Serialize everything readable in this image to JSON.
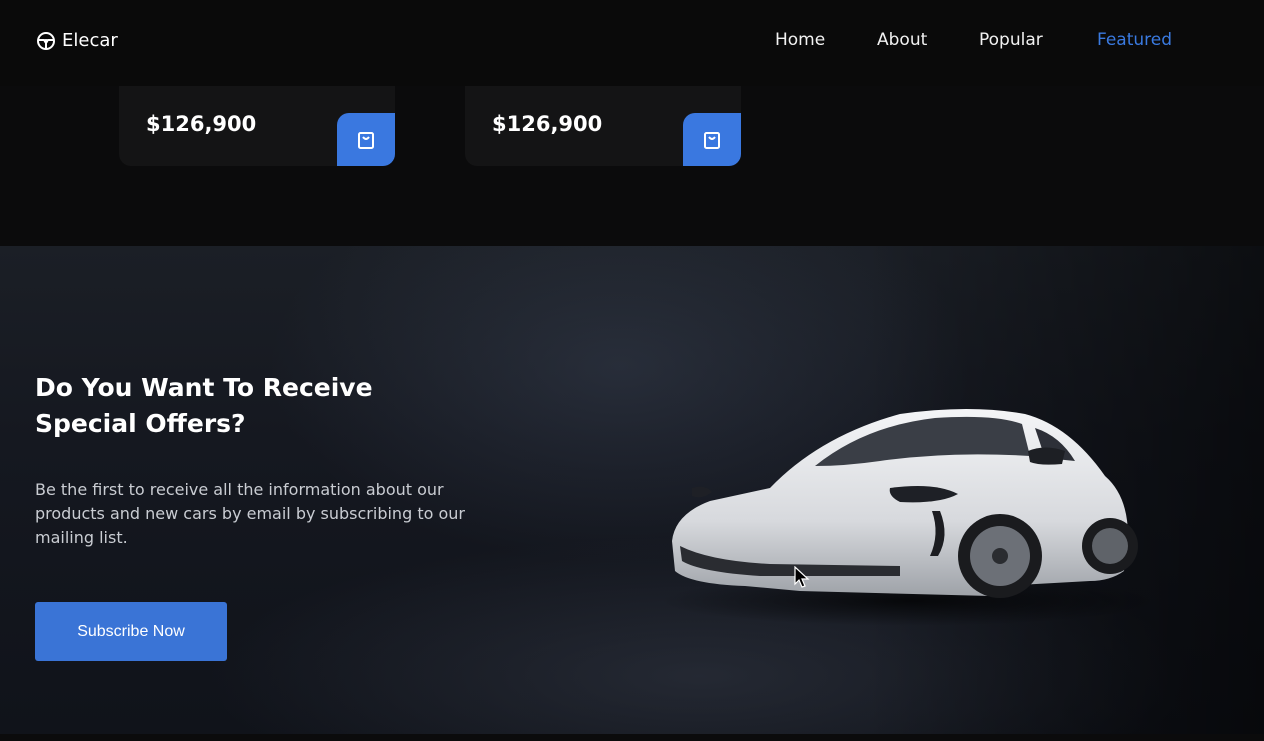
{
  "header": {
    "logo_text": "Elecar",
    "logo_icon": "steering-wheel-icon",
    "nav": [
      {
        "label": "Home",
        "active": false
      },
      {
        "label": "About",
        "active": false
      },
      {
        "label": "Popular",
        "active": false
      },
      {
        "label": "Featured",
        "active": true
      }
    ]
  },
  "featured": {
    "cards": [
      {
        "price": "$126,900",
        "cart_icon": "shopping-bag-icon"
      },
      {
        "price": "$126,900",
        "cart_icon": "shopping-bag-icon"
      }
    ]
  },
  "offer": {
    "title": "Do You Want To Receive Special Offers?",
    "text": "Be the first to receive all the information about our products and new cars by email by subscribing to our mailing list.",
    "button_label": "Subscribe Now"
  },
  "colors": {
    "accent": "#3a78e0",
    "background": "#0b0b0c",
    "active_nav": "#3a7ae0"
  }
}
